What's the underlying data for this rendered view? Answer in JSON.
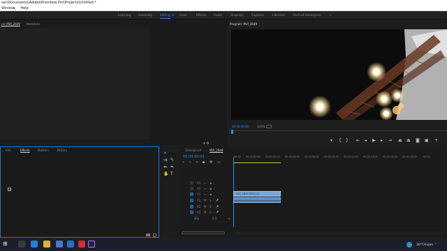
{
  "titlebar": {
    "text": "ser\\Documents\\Adobe\\Premiere Pro\\Projects\\Untitled *"
  },
  "menu": [
    "Window",
    "Help"
  ],
  "workspaces": [
    {
      "label": "Learning"
    },
    {
      "label": "Assembly"
    },
    {
      "label": "Editing"
    },
    {
      "label": "Color"
    },
    {
      "label": "Effects"
    },
    {
      "label": "Audio"
    },
    {
      "label": "Graphics"
    },
    {
      "label": "Captions"
    },
    {
      "label": "Libraries"
    },
    {
      "label": "Portrait Workspace"
    }
  ],
  "workspace_more": "»",
  "source_panel": {
    "tab1": "ce: MVI_2649",
    "tab2": "Metadata"
  },
  "program_panel": {
    "title": "Program: MVI_2649",
    "timecode": "00:00:00:00",
    "zoom": "100%"
  },
  "effects_panel": {
    "tabs": [
      "Info",
      "Effects",
      "Markers",
      "History"
    ]
  },
  "timeline": {
    "tabs": [
      "Untergrund",
      "MVI_2649"
    ],
    "timecode": "00:00:00:00",
    "ruler": [
      "00:00",
      "00:00:02:00",
      "00:00:04:00",
      "00:00:06:00",
      "00:00:08:00",
      "00:00:10:00",
      "00:00:12:00",
      "00:00:14:00",
      "00:00:16:00",
      "00:00:18:00",
      "00:00"
    ],
    "video_tracks": [
      "V3",
      "V2",
      "V1"
    ],
    "audio_tracks": [
      "A1",
      "A2",
      "A3"
    ],
    "master": "Mix",
    "master_value": "0.0",
    "clip_label": "MVI_2649.MOV [V]"
  },
  "taskbar": {
    "temp": "30°C",
    "weather": "Hujan"
  },
  "colors": {
    "accent": "#2d8ceb",
    "clip_video": "#7aa6d6",
    "clip_audio": "#5c8fc7"
  }
}
